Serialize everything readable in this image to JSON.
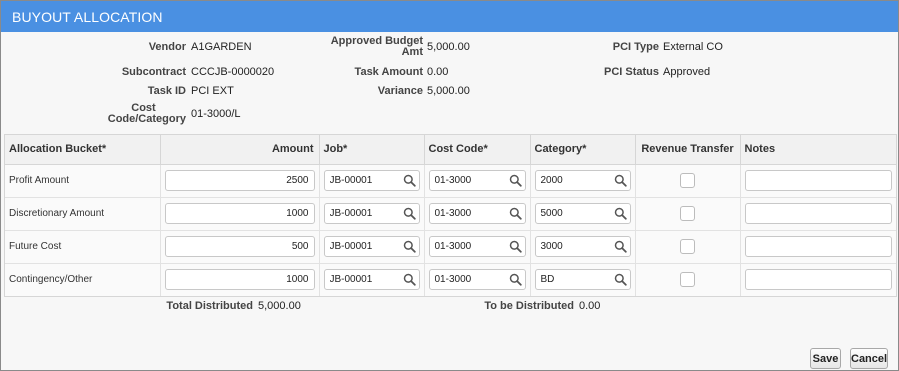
{
  "dialog": {
    "title": "BUYOUT ALLOCATION"
  },
  "info": {
    "vendor_label": "Vendor",
    "vendor": "A1GARDEN",
    "subcontract_label": "Subcontract",
    "subcontract": "CCCJB-0000020",
    "task_id_label": "Task ID",
    "task_id": "PCI EXT",
    "cost_code_label_1": "Cost",
    "cost_code_label_2": "Code/Category",
    "cost_code": "01-3000/L",
    "approved_budget_label_1": "Approved Budget",
    "approved_budget_label_2": "Amt",
    "approved_budget": "5,000.00",
    "task_amount_label": "Task Amount",
    "task_amount": "0.00",
    "variance_label": "Variance",
    "variance": "5,000.00",
    "pci_type_label": "PCI Type",
    "pci_type": "External CO",
    "pci_status_label": "PCI Status",
    "pci_status": "Approved"
  },
  "table": {
    "headers": {
      "bucket": "Allocation Bucket*",
      "amount": "Amount",
      "job": "Job*",
      "cost_code": "Cost Code*",
      "category": "Category*",
      "revenue_transfer": "Revenue Transfer",
      "notes": "Notes"
    },
    "rows": [
      {
        "bucket": "Profit Amount",
        "amount": "2500",
        "job": "JB-00001",
        "cost_code": "01-3000",
        "category": "2000",
        "revenue_transfer": false,
        "notes": ""
      },
      {
        "bucket": "Discretionary Amount",
        "amount": "1000",
        "job": "JB-00001",
        "cost_code": "01-3000",
        "category": "5000",
        "revenue_transfer": false,
        "notes": ""
      },
      {
        "bucket": "Future Cost",
        "amount": "500",
        "job": "JB-00001",
        "cost_code": "01-3000",
        "category": "3000",
        "revenue_transfer": false,
        "notes": ""
      },
      {
        "bucket": "Contingency/Other",
        "amount": "1000",
        "job": "JB-00001",
        "cost_code": "01-3000",
        "category": "BD",
        "revenue_transfer": false,
        "notes": ""
      }
    ]
  },
  "totals": {
    "total_distributed_label": "Total Distributed",
    "total_distributed": "5,000.00",
    "to_be_distributed_label": "To be Distributed",
    "to_be_distributed": "0.00"
  },
  "buttons": {
    "save": "Save",
    "cancel": "Cancel"
  },
  "icons": {
    "lookup": "search-icon"
  },
  "colors": {
    "titlebar": "#4a90e2",
    "title_text": "#ffffff"
  }
}
